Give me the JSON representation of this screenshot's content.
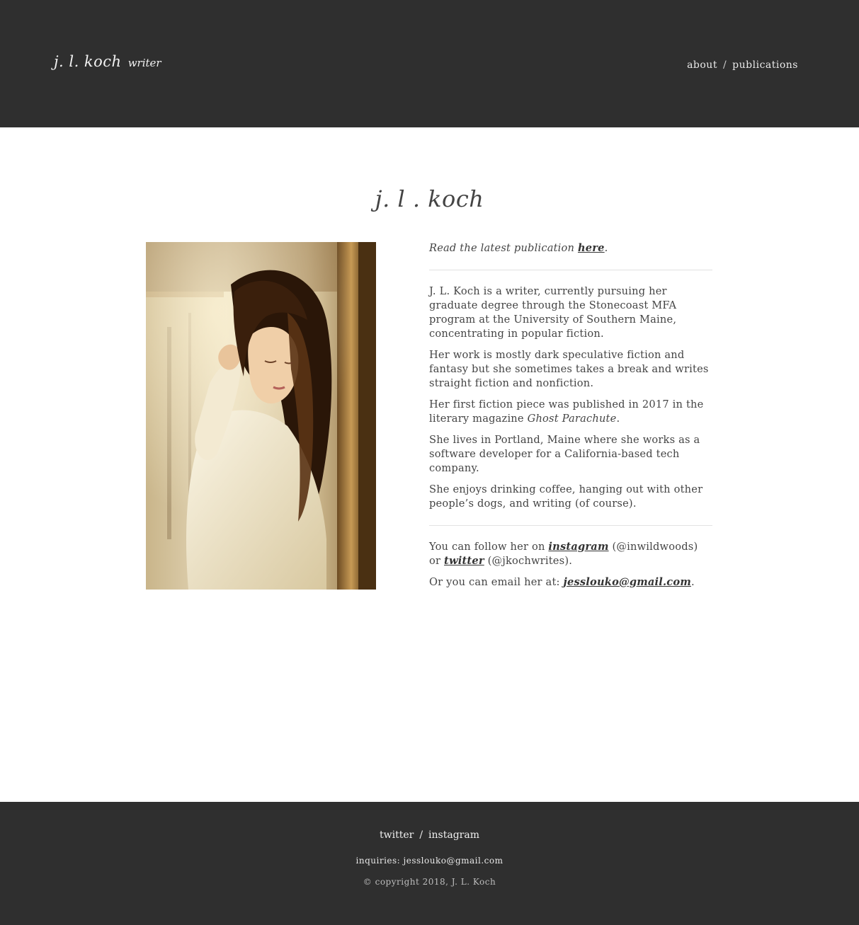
{
  "header": {
    "brand_name": "j. l. koch",
    "brand_tag": "writer",
    "nav": [
      {
        "label": "about"
      },
      {
        "label": "publications"
      }
    ],
    "nav_separator": "/"
  },
  "main": {
    "title": "j. l . koch",
    "lead_text": "Read the latest publication",
    "lead_link": "here",
    "bio": [
      "J. L. Koch is a writer, currently pursuing her graduate degree through the Stonecoast MFA program at the University of Southern Maine, concentrating in popular fiction.",
      "Her work is mostly dark speculative fiction and fantasy but she sometimes takes a break and writes straight fiction and nonfiction."
    ],
    "first_piece_text": "Her first fiction piece was published in 2017 in the literary magazine",
    "first_piece_magazine": "Ghost Parachute",
    "bio_more": [
      "She lives in Portland, Maine where she works as a software developer for a California-based tech company.",
      "She enjoys drinking coffee, hanging out with other people’s dogs, and writing (of course)."
    ],
    "follow_text": "You can follow her on",
    "instagram_link": "instagram",
    "instagram_handle": "(@inwildwoods)",
    "or_text": "or",
    "twitter_link": "twitter",
    "twitter_handle": "(@jkochwrites).",
    "email_text": "Or you can email her at:",
    "email_link": "jesslouko@gmail.com"
  },
  "footer": {
    "links": [
      {
        "label": "twitter"
      },
      {
        "label": "instagram"
      }
    ],
    "separator": "/",
    "inquiries": "inquiries: jesslouko@gmail.com",
    "copyright": "© copyright 2018, J. L. Koch"
  },
  "colors": {
    "header_bg": "#2f2f2f",
    "text": "#444444"
  }
}
